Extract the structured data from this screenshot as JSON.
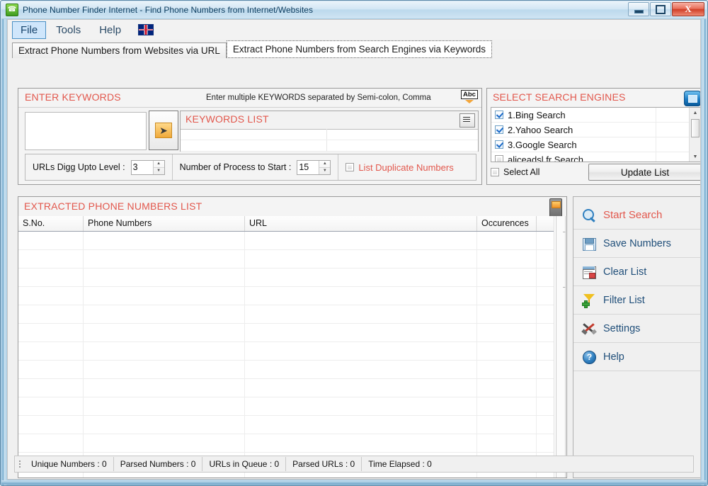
{
  "window": {
    "title": "Phone Number Finder Internet - Find Phone Numbers from Internet/Websites",
    "app_icon": "phone-icon",
    "minimize_label": "–",
    "maximize_label": "□",
    "close_label": "X"
  },
  "menubar": {
    "items": [
      {
        "label": "File",
        "active": true
      },
      {
        "label": "Tools",
        "active": false
      },
      {
        "label": "Help",
        "active": false
      }
    ],
    "flag_icon": "uk-flag-icon"
  },
  "tabs": [
    {
      "label": "Extract Phone Numbers from Websites via URL",
      "selected": false
    },
    {
      "label": "Extract Phone Numbers from Search Engines via Keywords",
      "selected": true
    }
  ],
  "keywords_panel": {
    "title": "ENTER KEYWORDS",
    "hint": "Enter multiple KEYWORDS separated by Semi-colon, Comma",
    "abc_icon": "spellcheck-abc-icon",
    "input_value": "",
    "input_placeholder": "",
    "add_button_icon": "arrow-right-icon",
    "list_title": "KEYWORDS LIST",
    "list_icon": "list-view-icon",
    "options": {
      "digg_label": "URLs Digg Upto Level :",
      "digg_value": "3",
      "process_label": "Number of Process to Start :",
      "process_value": "15",
      "duplicate_label": "List Duplicate Numbers",
      "duplicate_checked": false
    }
  },
  "engines_panel": {
    "title": "SELECT SEARCH ENGINES",
    "icon": "window-restore-icon",
    "items": [
      {
        "label": "1.Bing Search",
        "checked": true
      },
      {
        "label": "2.Yahoo Search",
        "checked": true
      },
      {
        "label": "3.Google Search",
        "checked": true
      },
      {
        "label": "aliceadsl.fr Search",
        "checked": false
      }
    ],
    "select_all_label": "Select All",
    "select_all_checked": false,
    "update_button_label": "Update List"
  },
  "extracted_panel": {
    "title": "EXTRACTED PHONE NUMBERS LIST",
    "icon": "mobile-phone-icon",
    "columns": [
      "S.No.",
      "Phone Numbers",
      "URL",
      "Occurences",
      ""
    ],
    "rows": []
  },
  "sidebar": {
    "buttons": [
      {
        "label": "Start Search",
        "icon": "search-icon",
        "primary": true
      },
      {
        "label": "Save Numbers",
        "icon": "save-icon",
        "primary": false
      },
      {
        "label": "Clear List",
        "icon": "clear-list-icon",
        "primary": false
      },
      {
        "label": "Filter List",
        "icon": "filter-icon",
        "primary": false
      },
      {
        "label": "Settings",
        "icon": "settings-icon",
        "primary": false
      },
      {
        "label": "Help",
        "icon": "help-icon",
        "primary": false
      }
    ]
  },
  "statusbar": {
    "cells": [
      "Unique Numbers :  0",
      "Parsed Numbers :  0",
      "URLs in Queue :  0",
      "Parsed URLs :  0",
      "Time Elapsed :  0"
    ]
  },
  "colors": {
    "accent_red": "#e2574c",
    "link_blue": "#1f4e79",
    "title_blue": "#0b3b5e"
  }
}
